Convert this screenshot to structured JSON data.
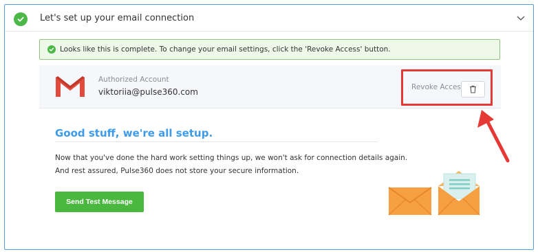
{
  "section": {
    "title": "Let's set up your email connection"
  },
  "alert": {
    "text": "Looks like this is complete. To change your email settings, click the 'Revoke Access' button."
  },
  "account": {
    "caption": "Authorized Account",
    "email": "viktoriia@pulse360.com",
    "revoke_label": "Revoke Access"
  },
  "setup": {
    "heading": "Good stuff, we're all setup.",
    "line1": "Now that you've done the hard work setting things up, we won't ask for connection details again.",
    "line2": "And rest assured, Pulse360 does not store your secure information.",
    "button_label": "Send Test Message"
  },
  "colors": {
    "success_green": "#4cb848",
    "heading_blue": "#3d9be9",
    "highlight_red": "#e53935",
    "card_border": "#5b9bd5"
  },
  "icons": {
    "status": "check-circle-icon",
    "collapse": "chevron-down-icon",
    "revoke": "trash-icon",
    "provider": "gmail-logo-icon",
    "illustration": "envelopes-illustration"
  }
}
